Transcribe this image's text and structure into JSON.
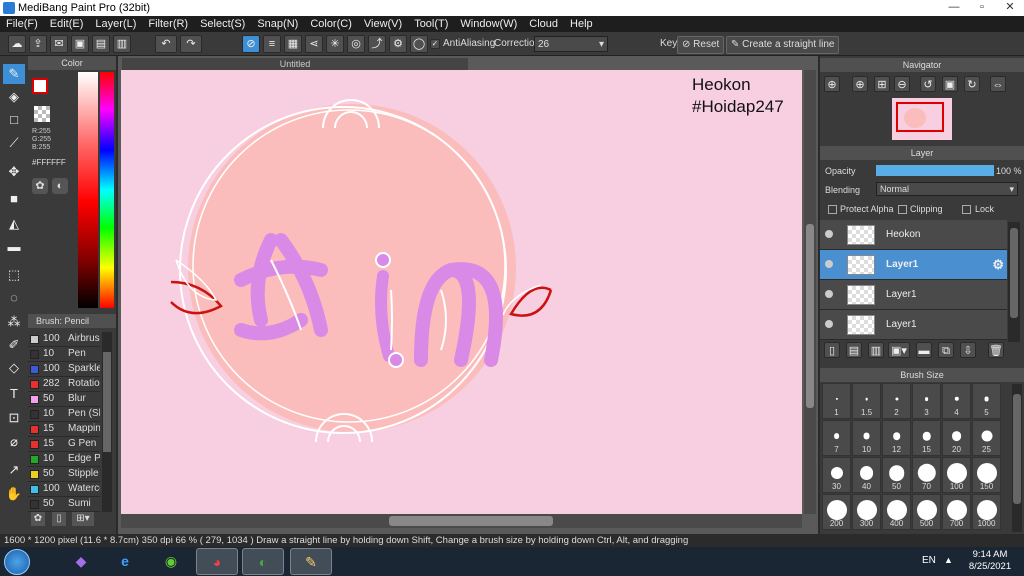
{
  "app": {
    "title": "MediBang Paint Pro (32bit)"
  },
  "menu": [
    "File(F)",
    "Edit(E)",
    "Layer(L)",
    "Filter(R)",
    "Select(S)",
    "Snap(N)",
    "Color(C)",
    "View(V)",
    "Tool(T)",
    "Window(W)",
    "Cloud",
    "Help"
  ],
  "toolbar": {
    "antialiasing_label": "AntiAliasing",
    "correction_label": "Correction",
    "correction_value": "26",
    "key_label": "Key",
    "reset_label": "Reset",
    "straight_line_label": "Create a straight line"
  },
  "color_panel": {
    "title": "Color",
    "r": "R:255",
    "g": "G:255",
    "b": "B:255",
    "hex": "#FFFFFF"
  },
  "brush_panel": {
    "title": "Brush: Pencil",
    "items": [
      {
        "size": "100",
        "name": "Airbrush",
        "color": "#cccccc"
      },
      {
        "size": "10",
        "name": "Pen",
        "color": "#333333"
      },
      {
        "size": "100",
        "name": "Sparkle",
        "color": "#3a5bd9"
      },
      {
        "size": "282",
        "name": "Rotation",
        "color": "#e83030"
      },
      {
        "size": "50",
        "name": "Blur",
        "color": "#f2a0f0"
      },
      {
        "size": "10",
        "name": "Pen (Sh",
        "color": "#333333"
      },
      {
        "size": "15",
        "name": "Mapping",
        "color": "#e83030"
      },
      {
        "size": "15",
        "name": "G Pen",
        "color": "#e83030"
      },
      {
        "size": "10",
        "name": "Edge Pe",
        "color": "#22aa22"
      },
      {
        "size": "50",
        "name": "Stipple",
        "color": "#e8d020"
      },
      {
        "size": "100",
        "name": "Watercol",
        "color": "#40c0e8"
      },
      {
        "size": "50",
        "name": "Sumi",
        "color": "#333333"
      }
    ]
  },
  "canvas": {
    "tab_title": "Untitled",
    "watermark_line1": "Heokon",
    "watermark_line2": "#Hoidap247"
  },
  "navigator": {
    "title": "Navigator"
  },
  "layer_panel": {
    "title": "Layer",
    "opacity_label": "Opacity",
    "opacity_value": "100 %",
    "opacity_fraction": 1.0,
    "blending_label": "Blending",
    "blending_value": "Normal",
    "protect_alpha": "Protect Alpha",
    "clipping": "Clipping",
    "lock": "Lock",
    "layers": [
      {
        "name": "Heokon",
        "selected": false
      },
      {
        "name": "Layer1",
        "selected": true
      },
      {
        "name": "Layer1",
        "selected": false
      },
      {
        "name": "Layer1",
        "selected": false
      }
    ]
  },
  "brush_size": {
    "title": "Brush Size",
    "sizes": [
      "1",
      "1.5",
      "2",
      "3",
      "4",
      "5",
      "7",
      "10",
      "12",
      "15",
      "20",
      "25",
      "30",
      "40",
      "50",
      "70",
      "100",
      "150",
      "200",
      "300",
      "400",
      "500",
      "700",
      "1000"
    ]
  },
  "status": {
    "text": "1600 * 1200 pixel   (11.6 * 8.7cm)   350 dpi   66 %   ( 279, 1034 )   Draw a straight line by holding down Shift, Change a brush size by holding down Ctrl, Alt, and dragging"
  },
  "taskbar": {
    "lang": "EN",
    "time": "9:14 AM",
    "date": "8/25/2021"
  },
  "colors": {
    "accent": "#3d8fd6",
    "canvas_bg": "#f7cfe0",
    "circle": "#fbbcbc",
    "letters": "#d88ae6",
    "red_leaf": "#cc1111"
  }
}
